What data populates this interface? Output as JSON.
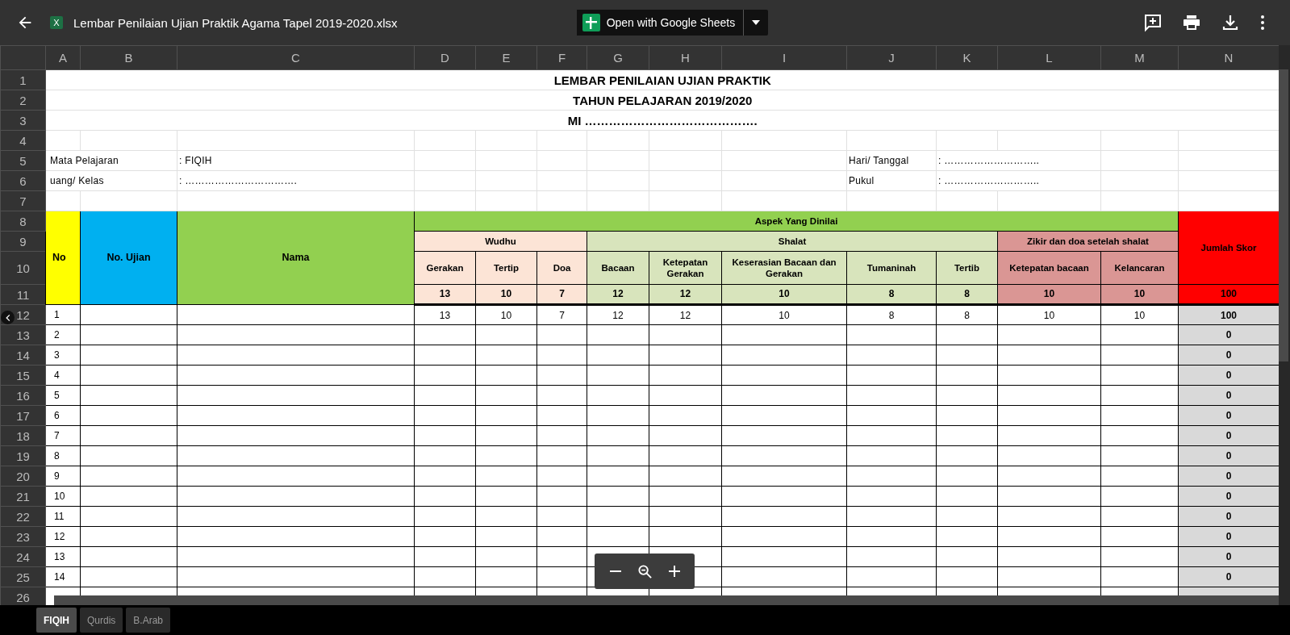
{
  "toolbar": {
    "file_icon_letter": "X",
    "file_name": "Lembar Penilaian Ujian Praktik Agama Tapel 2019-2020.xlsx",
    "open_button": "Open with Google Sheets"
  },
  "columns": [
    "A",
    "B",
    "C",
    "D",
    "E",
    "F",
    "G",
    "H",
    "I",
    "J",
    "K",
    "L",
    "M",
    "N"
  ],
  "row_numbers": [
    "1",
    "2",
    "3",
    "4",
    "5",
    "6",
    "7",
    "8",
    "9",
    "10",
    "11",
    "12",
    "13",
    "14",
    "15",
    "16",
    "17",
    "18",
    "19",
    "20",
    "21",
    "22",
    "23",
    "24",
    "25",
    "26"
  ],
  "title_lines": [
    "LEMBAR PENILAIAN UJIAN PRAKTIK",
    "TAHUN PELAJARAN 2019/2020",
    "MI ……………………………………."
  ],
  "info_rows": [
    {
      "left_label": "Mata Pelajaran",
      "left_value": ": FIQIH",
      "right_label": "Hari/ Tanggal",
      "right_value": ": ……………………….."
    },
    {
      "left_label": "uang/ Kelas",
      "left_value": ": …………………………….",
      "right_label": "Pukul",
      "right_value": ": ……………………….."
    }
  ],
  "id_columns": [
    {
      "label": "No",
      "color": "#ffff00"
    },
    {
      "label": "No. Ujian",
      "color": "#00b0f0"
    },
    {
      "label": "Nama",
      "color": "#92d050"
    }
  ],
  "aspects": {
    "title": "Aspek Yang Dinilai",
    "color": "#92d050",
    "groups": [
      {
        "label": "Wudhu",
        "color": "#fce4d6",
        "items": [
          {
            "label": "Gerakan",
            "max": "13"
          },
          {
            "label": "Tertip",
            "max": "10"
          },
          {
            "label": "Doa",
            "max": "7"
          }
        ]
      },
      {
        "label": "Shalat",
        "color": "#d8e4bc",
        "items": [
          {
            "label": "Bacaan",
            "max": "12"
          },
          {
            "label": "Ketepatan Gerakan",
            "max": "12"
          },
          {
            "label": "Keserasian Bacaan dan Gerakan",
            "max": "10"
          },
          {
            "label": "Tumaninah",
            "max": "8"
          },
          {
            "label": "Tertib",
            "max": "8"
          }
        ]
      },
      {
        "label": "Zikir dan doa setelah shalat",
        "color": "#da9694",
        "items": [
          {
            "label": "Ketepatan bacaan",
            "max": "10"
          },
          {
            "label": "Kelancaran",
            "max": "10"
          }
        ]
      }
    ]
  },
  "total_column": {
    "label": "Jumlah Skor",
    "max": "100",
    "color": "#ff0000"
  },
  "rows": [
    {
      "no": "1",
      "scores": [
        "13",
        "10",
        "7",
        "12",
        "12",
        "10",
        "8",
        "8",
        "10",
        "10"
      ],
      "total": "100"
    },
    {
      "no": "2",
      "total": "0"
    },
    {
      "no": "3",
      "total": "0"
    },
    {
      "no": "4",
      "total": "0"
    },
    {
      "no": "5",
      "total": "0"
    },
    {
      "no": "6",
      "total": "0"
    },
    {
      "no": "7",
      "total": "0"
    },
    {
      "no": "8",
      "total": "0"
    },
    {
      "no": "9",
      "total": "0"
    },
    {
      "no": "10",
      "total": "0"
    },
    {
      "no": "11",
      "total": "0"
    },
    {
      "no": "12",
      "total": "0"
    },
    {
      "no": "13",
      "total": "0"
    },
    {
      "no": "14",
      "total": "0"
    }
  ],
  "sheet_tabs": [
    {
      "label": "FIQIH",
      "selected": true
    },
    {
      "label": "Qurdis",
      "selected": false
    },
    {
      "label": "B.Arab",
      "selected": false
    }
  ]
}
